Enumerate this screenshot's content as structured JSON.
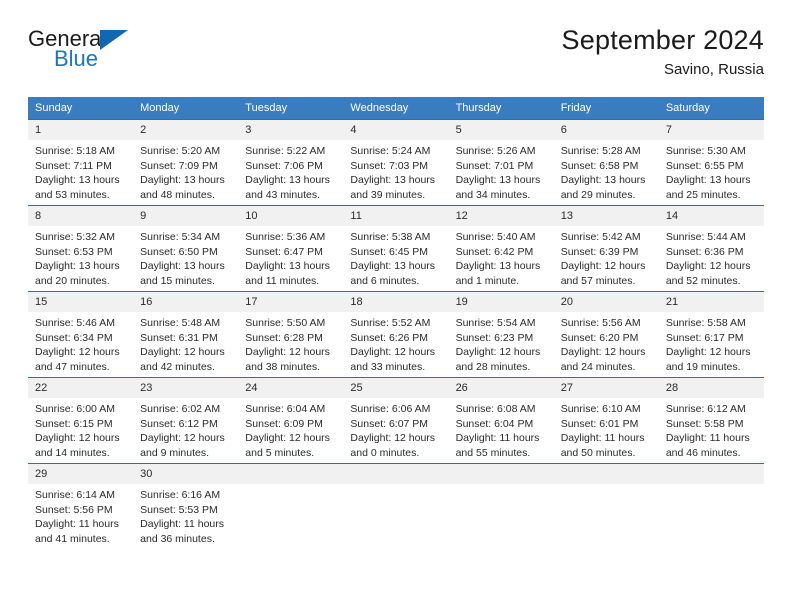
{
  "logo": {
    "text_top": "General",
    "text_bottom": "Blue",
    "accent_color": "#1167b1"
  },
  "header": {
    "title": "September 2024",
    "location": "Savino, Russia"
  },
  "theme": {
    "header_bar": "#3a7cc0",
    "row_border": "#2d6fa8",
    "daynum_bg": "#f1f1f1",
    "text": "#2b2b2b"
  },
  "weekday_headers": [
    "Sunday",
    "Monday",
    "Tuesday",
    "Wednesday",
    "Thursday",
    "Friday",
    "Saturday"
  ],
  "labels": {
    "sunrise_prefix": "Sunrise:",
    "sunset_prefix": "Sunset:",
    "daylight_prefix": "Daylight:"
  },
  "weeks": [
    [
      {
        "day": "1",
        "sunrise": "Sunrise: 5:18 AM",
        "sunset": "Sunset: 7:11 PM",
        "daylight_1": "Daylight: 13 hours",
        "daylight_2": "and 53 minutes."
      },
      {
        "day": "2",
        "sunrise": "Sunrise: 5:20 AM",
        "sunset": "Sunset: 7:09 PM",
        "daylight_1": "Daylight: 13 hours",
        "daylight_2": "and 48 minutes."
      },
      {
        "day": "3",
        "sunrise": "Sunrise: 5:22 AM",
        "sunset": "Sunset: 7:06 PM",
        "daylight_1": "Daylight: 13 hours",
        "daylight_2": "and 43 minutes."
      },
      {
        "day": "4",
        "sunrise": "Sunrise: 5:24 AM",
        "sunset": "Sunset: 7:03 PM",
        "daylight_1": "Daylight: 13 hours",
        "daylight_2": "and 39 minutes."
      },
      {
        "day": "5",
        "sunrise": "Sunrise: 5:26 AM",
        "sunset": "Sunset: 7:01 PM",
        "daylight_1": "Daylight: 13 hours",
        "daylight_2": "and 34 minutes."
      },
      {
        "day": "6",
        "sunrise": "Sunrise: 5:28 AM",
        "sunset": "Sunset: 6:58 PM",
        "daylight_1": "Daylight: 13 hours",
        "daylight_2": "and 29 minutes."
      },
      {
        "day": "7",
        "sunrise": "Sunrise: 5:30 AM",
        "sunset": "Sunset: 6:55 PM",
        "daylight_1": "Daylight: 13 hours",
        "daylight_2": "and 25 minutes."
      }
    ],
    [
      {
        "day": "8",
        "sunrise": "Sunrise: 5:32 AM",
        "sunset": "Sunset: 6:53 PM",
        "daylight_1": "Daylight: 13 hours",
        "daylight_2": "and 20 minutes."
      },
      {
        "day": "9",
        "sunrise": "Sunrise: 5:34 AM",
        "sunset": "Sunset: 6:50 PM",
        "daylight_1": "Daylight: 13 hours",
        "daylight_2": "and 15 minutes."
      },
      {
        "day": "10",
        "sunrise": "Sunrise: 5:36 AM",
        "sunset": "Sunset: 6:47 PM",
        "daylight_1": "Daylight: 13 hours",
        "daylight_2": "and 11 minutes."
      },
      {
        "day": "11",
        "sunrise": "Sunrise: 5:38 AM",
        "sunset": "Sunset: 6:45 PM",
        "daylight_1": "Daylight: 13 hours",
        "daylight_2": "and 6 minutes."
      },
      {
        "day": "12",
        "sunrise": "Sunrise: 5:40 AM",
        "sunset": "Sunset: 6:42 PM",
        "daylight_1": "Daylight: 13 hours",
        "daylight_2": "and 1 minute."
      },
      {
        "day": "13",
        "sunrise": "Sunrise: 5:42 AM",
        "sunset": "Sunset: 6:39 PM",
        "daylight_1": "Daylight: 12 hours",
        "daylight_2": "and 57 minutes."
      },
      {
        "day": "14",
        "sunrise": "Sunrise: 5:44 AM",
        "sunset": "Sunset: 6:36 PM",
        "daylight_1": "Daylight: 12 hours",
        "daylight_2": "and 52 minutes."
      }
    ],
    [
      {
        "day": "15",
        "sunrise": "Sunrise: 5:46 AM",
        "sunset": "Sunset: 6:34 PM",
        "daylight_1": "Daylight: 12 hours",
        "daylight_2": "and 47 minutes."
      },
      {
        "day": "16",
        "sunrise": "Sunrise: 5:48 AM",
        "sunset": "Sunset: 6:31 PM",
        "daylight_1": "Daylight: 12 hours",
        "daylight_2": "and 42 minutes."
      },
      {
        "day": "17",
        "sunrise": "Sunrise: 5:50 AM",
        "sunset": "Sunset: 6:28 PM",
        "daylight_1": "Daylight: 12 hours",
        "daylight_2": "and 38 minutes."
      },
      {
        "day": "18",
        "sunrise": "Sunrise: 5:52 AM",
        "sunset": "Sunset: 6:26 PM",
        "daylight_1": "Daylight: 12 hours",
        "daylight_2": "and 33 minutes."
      },
      {
        "day": "19",
        "sunrise": "Sunrise: 5:54 AM",
        "sunset": "Sunset: 6:23 PM",
        "daylight_1": "Daylight: 12 hours",
        "daylight_2": "and 28 minutes."
      },
      {
        "day": "20",
        "sunrise": "Sunrise: 5:56 AM",
        "sunset": "Sunset: 6:20 PM",
        "daylight_1": "Daylight: 12 hours",
        "daylight_2": "and 24 minutes."
      },
      {
        "day": "21",
        "sunrise": "Sunrise: 5:58 AM",
        "sunset": "Sunset: 6:17 PM",
        "daylight_1": "Daylight: 12 hours",
        "daylight_2": "and 19 minutes."
      }
    ],
    [
      {
        "day": "22",
        "sunrise": "Sunrise: 6:00 AM",
        "sunset": "Sunset: 6:15 PM",
        "daylight_1": "Daylight: 12 hours",
        "daylight_2": "and 14 minutes."
      },
      {
        "day": "23",
        "sunrise": "Sunrise: 6:02 AM",
        "sunset": "Sunset: 6:12 PM",
        "daylight_1": "Daylight: 12 hours",
        "daylight_2": "and 9 minutes."
      },
      {
        "day": "24",
        "sunrise": "Sunrise: 6:04 AM",
        "sunset": "Sunset: 6:09 PM",
        "daylight_1": "Daylight: 12 hours",
        "daylight_2": "and 5 minutes."
      },
      {
        "day": "25",
        "sunrise": "Sunrise: 6:06 AM",
        "sunset": "Sunset: 6:07 PM",
        "daylight_1": "Daylight: 12 hours",
        "daylight_2": "and 0 minutes."
      },
      {
        "day": "26",
        "sunrise": "Sunrise: 6:08 AM",
        "sunset": "Sunset: 6:04 PM",
        "daylight_1": "Daylight: 11 hours",
        "daylight_2": "and 55 minutes."
      },
      {
        "day": "27",
        "sunrise": "Sunrise: 6:10 AM",
        "sunset": "Sunset: 6:01 PM",
        "daylight_1": "Daylight: 11 hours",
        "daylight_2": "and 50 minutes."
      },
      {
        "day": "28",
        "sunrise": "Sunrise: 6:12 AM",
        "sunset": "Sunset: 5:58 PM",
        "daylight_1": "Daylight: 11 hours",
        "daylight_2": "and 46 minutes."
      }
    ],
    [
      {
        "day": "29",
        "sunrise": "Sunrise: 6:14 AM",
        "sunset": "Sunset: 5:56 PM",
        "daylight_1": "Daylight: 11 hours",
        "daylight_2": "and 41 minutes."
      },
      {
        "day": "30",
        "sunrise": "Sunrise: 6:16 AM",
        "sunset": "Sunset: 5:53 PM",
        "daylight_1": "Daylight: 11 hours",
        "daylight_2": "and 36 minutes."
      },
      {
        "day": "",
        "sunrise": "",
        "sunset": "",
        "daylight_1": "",
        "daylight_2": ""
      },
      {
        "day": "",
        "sunrise": "",
        "sunset": "",
        "daylight_1": "",
        "daylight_2": ""
      },
      {
        "day": "",
        "sunrise": "",
        "sunset": "",
        "daylight_1": "",
        "daylight_2": ""
      },
      {
        "day": "",
        "sunrise": "",
        "sunset": "",
        "daylight_1": "",
        "daylight_2": ""
      },
      {
        "day": "",
        "sunrise": "",
        "sunset": "",
        "daylight_1": "",
        "daylight_2": ""
      }
    ]
  ]
}
